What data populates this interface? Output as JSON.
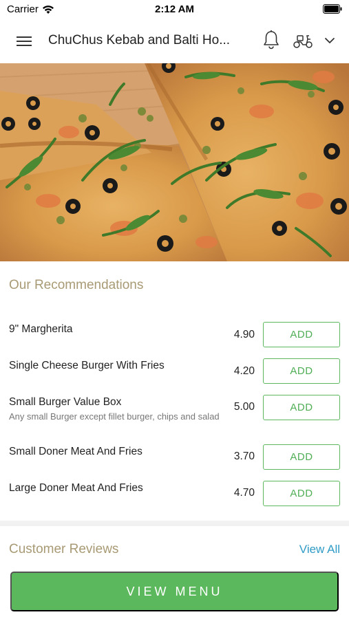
{
  "status_bar": {
    "carrier": "Carrier",
    "time": "2:12 AM"
  },
  "header": {
    "title": "ChuChus Kebab and Balti Ho...",
    "menu_icon": "hamburger-menu-icon",
    "notification_icon": "bell-icon",
    "delivery_icon": "scooter-icon",
    "dropdown_icon": "chevron-down-icon"
  },
  "hero": {
    "image": "pizza-photo"
  },
  "recommendations": {
    "title": "Our Recommendations",
    "items": [
      {
        "name": "9\" Margherita",
        "description": "",
        "price": "4.90",
        "add_label": "ADD"
      },
      {
        "name": "Single Cheese Burger With Fries",
        "description": "",
        "price": "4.20",
        "add_label": "ADD"
      },
      {
        "name": "Small Burger Value Box",
        "description": "Any small Burger except fillet burger, chips and salad",
        "price": "5.00",
        "add_label": "ADD"
      },
      {
        "name": "Small Doner Meat And Fries",
        "description": "",
        "price": "3.70",
        "add_label": "ADD"
      },
      {
        "name": "Large Doner Meat And Fries",
        "description": "",
        "price": "4.70",
        "add_label": "ADD"
      }
    ]
  },
  "reviews": {
    "title": "Customer Reviews",
    "view_all_label": "View All"
  },
  "footer": {
    "view_menu_label": "VIEW MENU"
  },
  "colors": {
    "accent_green": "#5cb85c",
    "section_title": "#a89a74",
    "link_blue": "#2f9bc7"
  }
}
